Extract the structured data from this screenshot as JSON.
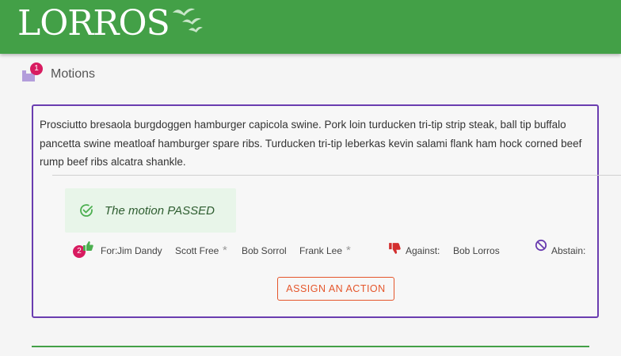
{
  "app": {
    "logo_text": "LORROS"
  },
  "section": {
    "title": "Motions",
    "badge_count": "1"
  },
  "motion": {
    "text": "Prosciutto bresaola burgdoggen hamburger capicola swine. Pork loin turducken tri-tip strip steak, ball tip buffalo pancetta swine meatloaf hamburger spare ribs. Turducken tri-tip leberkas kevin salami flank ham hock corned beef rump beef ribs alcatra shankle.",
    "result": "The motion PASSED",
    "for_badge": "2",
    "for_label": "For:",
    "for_voters": [
      {
        "name": "Jim Dandy",
        "star": ""
      },
      {
        "name": "Scott Free",
        "star": "*"
      },
      {
        "name": "Bob Sorrol",
        "star": ""
      },
      {
        "name": "Frank Lee",
        "star": "*"
      }
    ],
    "against_label": "Against:",
    "against_voters": [
      "Bob Lorros"
    ],
    "abstain_label": "Abstain:",
    "assign_action_label": "ASSIGN AN ACTION"
  },
  "colors": {
    "brand_green": "#43a047",
    "card_border_purple": "#6a3db0",
    "badge_pink": "#d81b60",
    "passed_green": "#2e5d30",
    "action_orange": "#e5562b",
    "against_red": "#d32f2f"
  },
  "icons": {
    "logo_birds": "birds-icon",
    "motions": "motions-icon",
    "result": "check-circle-icon",
    "for": "thumbs-up-icon",
    "against": "thumbs-down-icon",
    "abstain": "block-icon"
  }
}
